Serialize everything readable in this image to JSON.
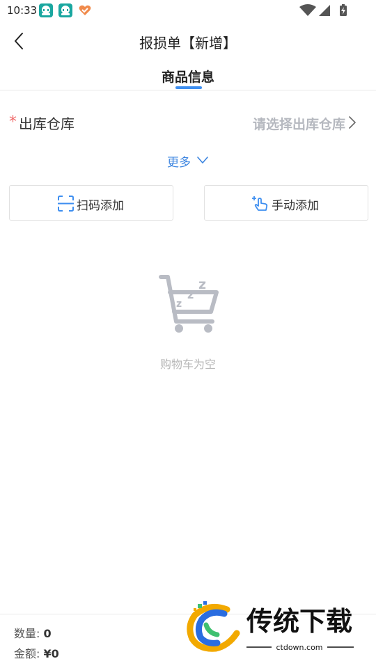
{
  "status_bar": {
    "time": "10:33",
    "icons": [
      "app-badge-icon",
      "app-badge-icon",
      "heart-app-icon",
      "wifi-icon",
      "signal-icon",
      "battery-icon"
    ]
  },
  "nav": {
    "back_icon": "chevron-left-icon",
    "title": "报损单【新增】"
  },
  "tabs": [
    {
      "label": "商品信息",
      "active": true
    }
  ],
  "form": {
    "warehouse": {
      "required_mark": "*",
      "label": "出库仓库",
      "placeholder": "请选择出库仓库"
    },
    "more": {
      "label": "更多"
    }
  },
  "actions": {
    "scan_add": {
      "label": "扫码添加",
      "icon": "scan-icon"
    },
    "manual_add": {
      "label": "手动添加",
      "icon": "hand-tap-icon"
    }
  },
  "empty_state": {
    "icon": "sleeping-cart-icon",
    "text": "购物车为空"
  },
  "footer": {
    "quantity_label": "数量:",
    "quantity_value": "0",
    "amount_label": "金额:",
    "amount_value": "¥0"
  },
  "watermark": {
    "brand": "传统下载",
    "url": "ctdown.com"
  },
  "colors": {
    "accent": "#3d8ef0",
    "link": "#3b84e0",
    "required": "#f06a6a",
    "placeholder": "#b5b8bf",
    "icon_gray": "#b9bcc4"
  }
}
